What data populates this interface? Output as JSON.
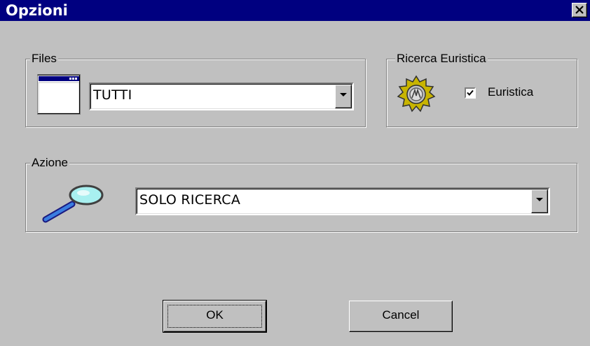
{
  "window": {
    "title": "Opzioni",
    "close_icon": "close-icon"
  },
  "files": {
    "legend": "Files",
    "icon": "window-icon",
    "selected": "TUTTI"
  },
  "heuristic": {
    "legend": "Ricerca Euristica",
    "icon": "gear-icon",
    "checkbox_label": "Euristica",
    "checked": true
  },
  "action": {
    "legend": "Azione",
    "icon": "magnifier-icon",
    "selected": "SOLO RICERCA"
  },
  "buttons": {
    "ok_label": "OK",
    "cancel_label": "Cancel"
  },
  "colors": {
    "titlebar": "#000080",
    "face": "#c0c0c0"
  }
}
